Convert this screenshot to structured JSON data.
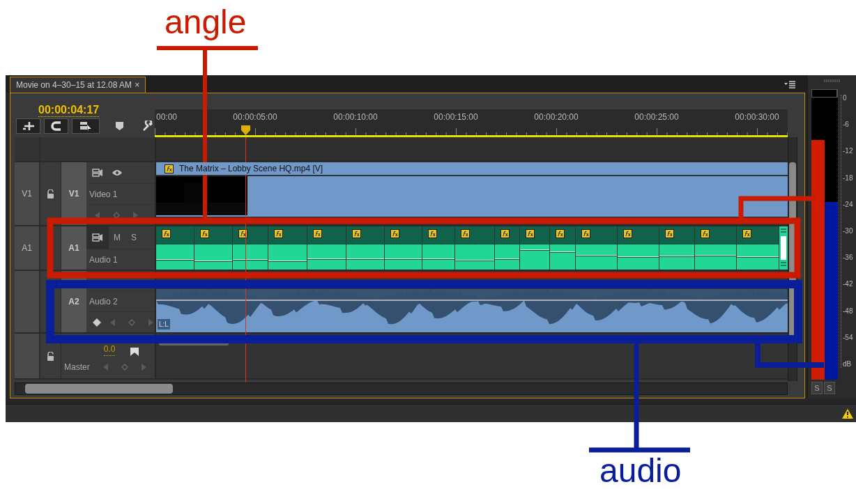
{
  "panel": {
    "title": "Movie on 4–30–15 at 12.08 AM",
    "close": "×"
  },
  "timecode": "00:00:04:17",
  "ruler": [
    "00:00",
    "00:00:05:00",
    "00:00:10:00",
    "00:00:15:00",
    "00:00:20:00",
    "00:00:25:00",
    "00:00:30:00"
  ],
  "tracks": [
    {
      "kind": "video",
      "source": "V1",
      "target": "V1",
      "name": "Video 1",
      "clip": {
        "title": "The Matrix – Lobby Scene HQ.mp4 [V]"
      }
    },
    {
      "kind": "audio",
      "source": "A1",
      "target": "A1",
      "name": "Audio 1",
      "buttons": [
        "M",
        "S"
      ]
    },
    {
      "kind": "waveform",
      "target": "A2",
      "name": "Audio 2",
      "clip": {
        "channel": "L:L"
      }
    },
    {
      "kind": "master",
      "name": "Master",
      "value": "0.0"
    }
  ],
  "meter": {
    "scale": [
      "0",
      "-6",
      "-12",
      "-18",
      "-24",
      "-30",
      "-36",
      "-42",
      "-48",
      "-54",
      "dB"
    ],
    "channels": [
      {
        "level": 0.85,
        "color": "#d01c00"
      },
      {
        "level": 0.63,
        "color": "#0018a0"
      }
    ],
    "solo": [
      "S",
      "S"
    ]
  },
  "annotations": [
    {
      "label": "angle",
      "color": "#cc1a00"
    },
    {
      "label": "audio",
      "color": "#0a1e9a"
    }
  ]
}
